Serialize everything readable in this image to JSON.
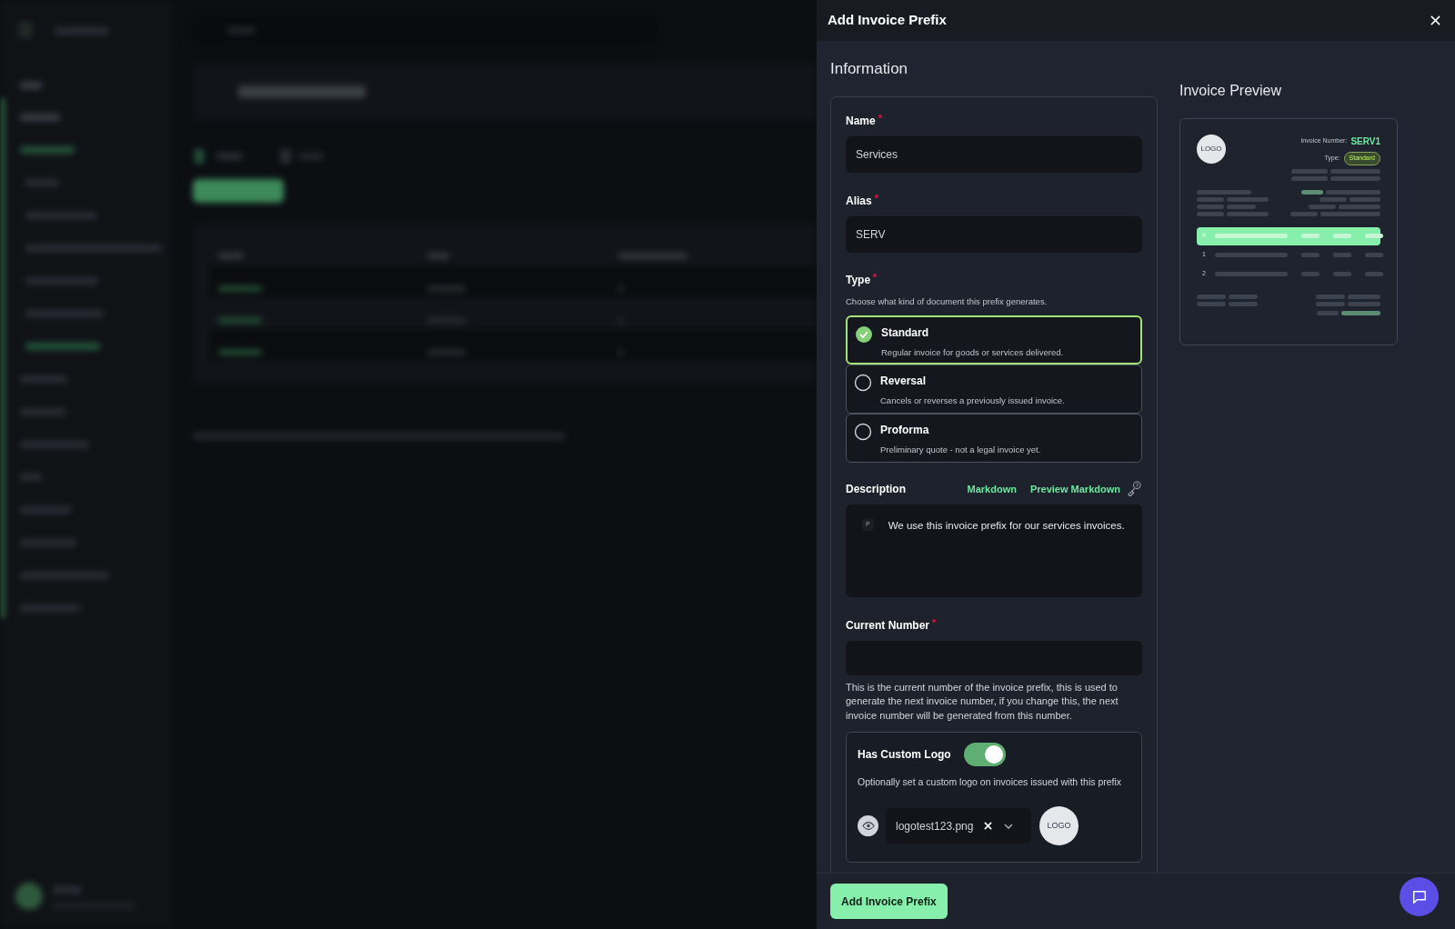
{
  "drawer": {
    "title": "Add Invoice Prefix",
    "section": "Information",
    "fields": [
      {
        "label": "Name",
        "required": true,
        "value": "Services"
      },
      {
        "label": "Alias",
        "required": true,
        "value": "SERV"
      }
    ],
    "type": {
      "label": "Type",
      "required": true,
      "hint": "Choose what kind of document this prefix generates.",
      "options": [
        {
          "title": "Standard",
          "description": "Regular invoice for goods or services delivered.",
          "selected": true
        },
        {
          "title": "Reversal",
          "description": "Cancels or reverses a previously issued invoice.",
          "selected": false
        },
        {
          "title": "Proforma",
          "description": "Preliminary quote - not a legal invoice yet.",
          "selected": false
        }
      ]
    },
    "description": {
      "label": "Description",
      "tabs": [
        "Markdown",
        "Preview Markdown"
      ],
      "block_tag": "P",
      "text": "We use this invoice prefix for our services invoices."
    },
    "current_number": {
      "label": "Current Number",
      "required": true,
      "help": "This is the current number of the invoice prefix, this is used to generate the next invoice number, if you change this, the next invoice number will be generated from this number."
    },
    "custom_logo": {
      "label": "Has Custom Logo",
      "on": true,
      "hint": "Optionally set a custom logo on invoices issued with this prefix",
      "file": "logotest123.png",
      "logo_text": "LOGO"
    },
    "preview": {
      "title": "Invoice Preview",
      "logo_text": "LOGO",
      "number_label": "Invoice Number:",
      "number": "SERV1",
      "type_label": "Type:",
      "type_value": "Standard",
      "row_numbers": [
        "#",
        "1",
        "2"
      ]
    },
    "submit": "Add Invoice Prefix"
  }
}
